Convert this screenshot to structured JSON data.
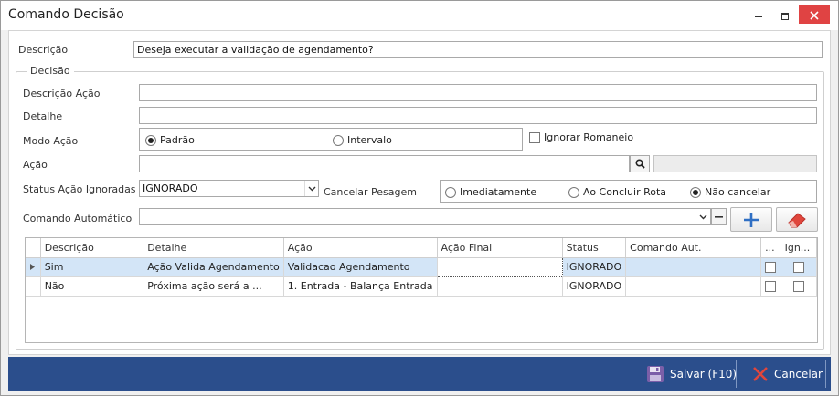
{
  "window": {
    "title": "Comando Decisão"
  },
  "form": {
    "descricao_label": "Descrição",
    "descricao_value": "Deseja executar a validação de agendamento?",
    "decisao_group": "Decisão",
    "descricao_acao_label": "Descrição Ação",
    "descricao_acao_value": "",
    "detalhe_label": "Detalhe",
    "detalhe_value": "",
    "modo_acao_label": "Modo Ação",
    "modo_options": [
      "Padrão",
      "Intervalo"
    ],
    "modo_selected": "Padrão",
    "ignorar_romaneio_label": "Ignorar Romaneio",
    "acao_label": "Ação",
    "acao_value": "",
    "status_acao_label": "Status Ação Ignoradas",
    "status_acao_value": "IGNORADO",
    "cancelar_pesagem_label": "Cancelar Pesagem",
    "cancelar_options": [
      "Imediatamente",
      "Ao Concluir Rota",
      "Não cancelar"
    ],
    "cancelar_selected": "Não cancelar",
    "comando_automatico_label": "Comando Automático",
    "comando_automatico_value": ""
  },
  "grid": {
    "columns": [
      "Descrição",
      "Detalhe",
      "Ação",
      "Ação Final",
      "Status",
      "Comando Aut.",
      "...",
      "Ign..."
    ],
    "rows": [
      {
        "descricao": "Sim",
        "detalhe": "Ação Valida Agendamento",
        "acao": "Validacao Agendamento",
        "acao_final": "",
        "status": "IGNORADO",
        "comando_aut": ""
      },
      {
        "descricao": "Não",
        "detalhe": "Próxima ação será a ...",
        "acao": "1. Entrada - Balança Entrada",
        "acao_final": "",
        "status": "IGNORADO",
        "comando_aut": ""
      }
    ]
  },
  "footer": {
    "save_label": "Salvar (F10)",
    "cancel_label": "Cancelar"
  },
  "colors": {
    "footer_bg": "#2b4e8c",
    "selected_row": "#d3e5f7",
    "close_button": "#e04343",
    "add_button_icon": "#2f6fc4",
    "eraser_icon": "#e0463c"
  }
}
